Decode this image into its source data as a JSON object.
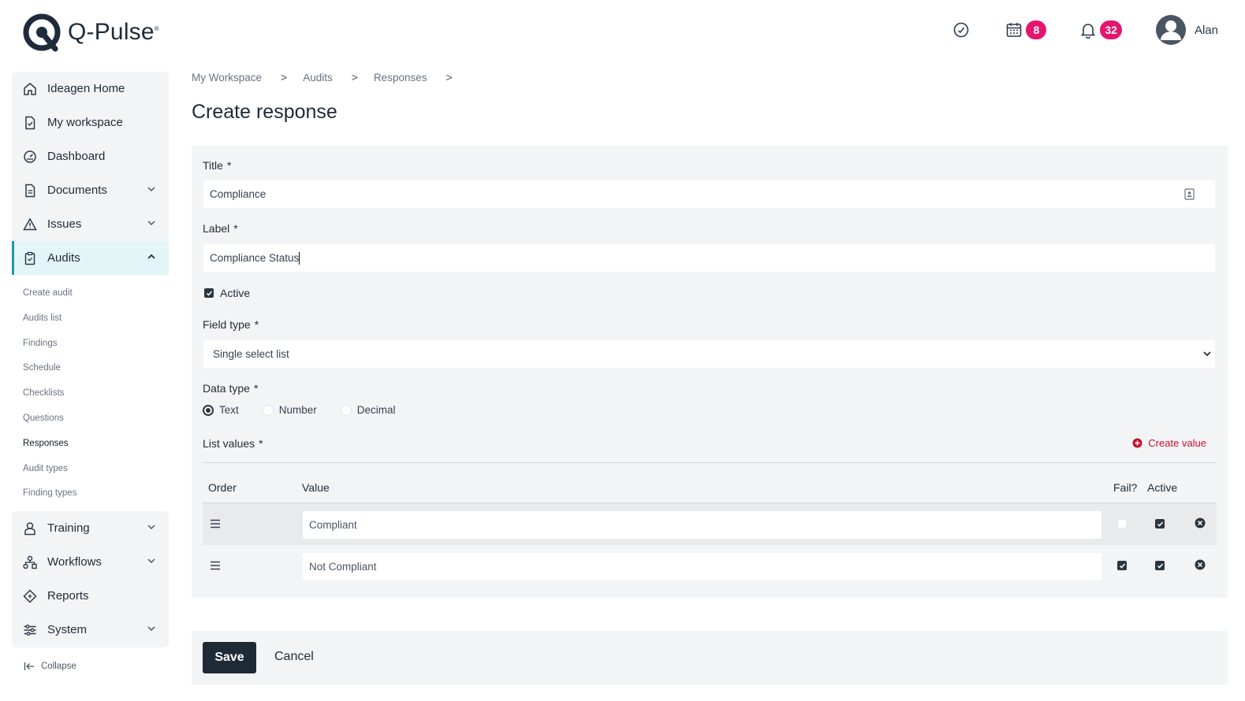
{
  "app": {
    "name": "Q-Pulse",
    "trademark": "®"
  },
  "header": {
    "calendar_count": "8",
    "notifications_count": "32",
    "user_name": "Alan"
  },
  "sidebar": {
    "items": [
      {
        "label": "Ideagen Home",
        "icon": "home-icon"
      },
      {
        "label": "My workspace",
        "icon": "document-check-icon"
      },
      {
        "label": "Dashboard",
        "icon": "gauge-icon"
      },
      {
        "label": "Documents",
        "icon": "document-icon"
      },
      {
        "label": "Issues",
        "icon": "warning-icon"
      },
      {
        "label": "Audits",
        "icon": "clipboard-icon"
      }
    ],
    "audit_sub_items": [
      "Create audit",
      "Audits list",
      "Findings",
      "Schedule",
      "Checklists",
      "Questions",
      "Responses",
      "Audit types",
      "Finding types"
    ],
    "lower_items": [
      {
        "label": "Training",
        "icon": "training-icon"
      },
      {
        "label": "Workflows",
        "icon": "workflow-icon"
      },
      {
        "label": "Reports",
        "icon": "reports-icon"
      },
      {
        "label": "System",
        "icon": "sliders-icon"
      }
    ],
    "collapse_label": "Collapse"
  },
  "breadcrumb": [
    "My Workspace",
    "Audits",
    "Responses"
  ],
  "page_title": "Create response",
  "form": {
    "title_label": "Title",
    "title_value": "Compliance",
    "label_label": "Label",
    "label_value": "Compliance Status",
    "active_label": "Active",
    "field_type_label": "Field type",
    "field_type_value": "Single select list",
    "data_type_label": "Data type",
    "data_type_options": [
      "Text",
      "Number",
      "Decimal"
    ],
    "data_type_selected": "Text",
    "list_values_label": "List values",
    "create_value_label": "Create value",
    "required_marker": "*"
  },
  "list_table": {
    "headers": {
      "order": "Order",
      "value": "Value",
      "fail": "Fail?",
      "active": "Active"
    },
    "rows": [
      {
        "value": "Compliant",
        "fail": false,
        "active": true
      },
      {
        "value": "Not Compliant",
        "fail": true,
        "active": true
      }
    ]
  },
  "footer": {
    "save_label": "Save",
    "cancel_label": "Cancel"
  },
  "colors": {
    "accent": "#1e9aa6",
    "badge": "#e5156e",
    "primary_button": "#1f2a37",
    "create_link": "#c8102e"
  }
}
